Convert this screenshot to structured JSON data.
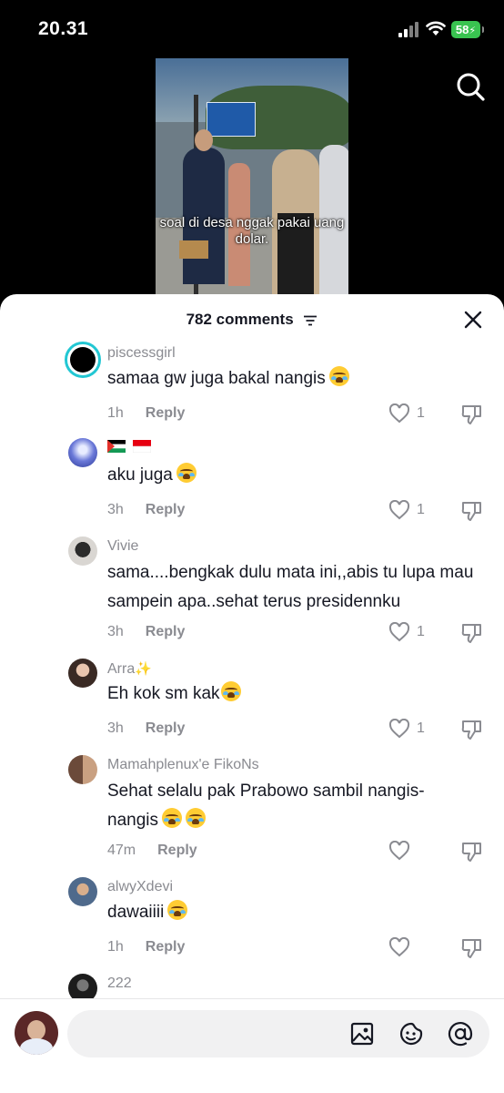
{
  "status_bar": {
    "time": "20.31",
    "battery": "58"
  },
  "video": {
    "caption_line1": "soal di desa nggak pakai uang",
    "caption_line2": "dolar."
  },
  "comments_header": {
    "count_label": "782 comments"
  },
  "comments": [
    {
      "username": "piscessgirl",
      "text": "samaa gw juga bakal nangis",
      "emoji_count": 1,
      "time": "1h",
      "reply": "Reply",
      "likes": "1"
    },
    {
      "username": "",
      "flags": [
        "palestine-flag",
        "indonesia-flag"
      ],
      "text": "aku juga",
      "emoji_count": 1,
      "time": "3h",
      "reply": "Reply",
      "likes": "1"
    },
    {
      "username": "Vivie",
      "text": "sama....bengkak dulu mata ini,,abis tu lupa mau sampein apa..sehat terus presidennku",
      "emoji_count": 0,
      "time": "3h",
      "reply": "Reply",
      "likes": "1"
    },
    {
      "username": "Arra",
      "username_suffix_icon": "sparkles-icon",
      "text": "Eh kok sm kak",
      "emoji_count": 1,
      "time": "3h",
      "reply": "Reply",
      "likes": "1"
    },
    {
      "username": "Mamahplenux'e FikoNs",
      "text": "Sehat selalu pak Prabowo sambil nangis-nangis",
      "emoji_count": 2,
      "time": "47m",
      "reply": "Reply",
      "likes": ""
    },
    {
      "username": "alwyXdevi",
      "text": "dawaiiii",
      "emoji_count": 1,
      "time": "1h",
      "reply": "Reply",
      "likes": ""
    },
    {
      "username": "222",
      "text": "",
      "emoji_count": 0,
      "time": "",
      "reply": "",
      "likes": ""
    }
  ],
  "icons": {
    "emoji": "loudly-crying-face-emoji",
    "search": "search-icon",
    "close": "close-icon",
    "like": "heart-icon",
    "dislike": "thumbs-down-icon",
    "image": "image-icon",
    "sticker": "sticker-icon",
    "mention": "at-icon"
  },
  "colors": {
    "battery": "#39c350",
    "text_primary": "#161823",
    "text_secondary": "#8a8b91",
    "live_ring": "#22c7d3"
  }
}
